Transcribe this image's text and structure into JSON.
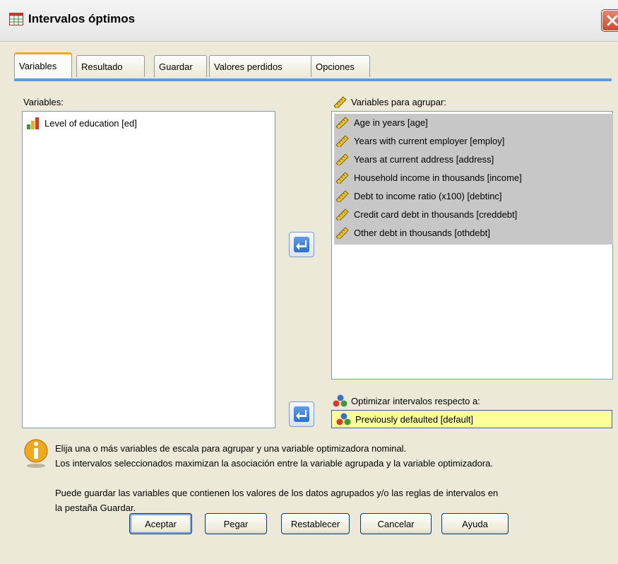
{
  "window": {
    "title": "Intervalos óptimos"
  },
  "tabs": [
    {
      "label": "Variables",
      "active": true
    },
    {
      "label": "Resultado",
      "active": false
    },
    {
      "label": "Guardar",
      "active": false
    },
    {
      "label": "Valores perdidos",
      "active": false
    },
    {
      "label": "Opciones",
      "active": false
    }
  ],
  "source_list": {
    "label": "Variables:",
    "items": [
      {
        "label": "Level of education [ed]",
        "icon": "ordinal-bar-icon"
      }
    ]
  },
  "bin_list": {
    "label": "Variables para agrupar:",
    "icon": "ruler-icon",
    "items": [
      {
        "label": "Age in years [age]",
        "icon": "ruler-icon"
      },
      {
        "label": "Years with current employer [employ]",
        "icon": "ruler-icon"
      },
      {
        "label": "Years at current address [address]",
        "icon": "ruler-icon"
      },
      {
        "label": "Household income in thousands [income]",
        "icon": "ruler-icon"
      },
      {
        "label": "Debt to income ratio (x100) [debtinc]",
        "icon": "ruler-icon"
      },
      {
        "label": "Credit card debt in thousands [creddebt]",
        "icon": "ruler-icon"
      },
      {
        "label": "Other debt in thousands [othdebt]",
        "icon": "ruler-icon"
      }
    ]
  },
  "optimize": {
    "label": "Optimizar intervalos respecto a:",
    "icon": "nominal-icon",
    "value": "Previously defaulted [default]"
  },
  "info": {
    "icon": "info-icon",
    "line1": "Elija una o más variables de escala para agrupar y una variable optimizadora nominal.",
    "line2": "Los intervalos seleccionados maximizan la asociación entre la variable agrupada y la variable optimizadora.",
    "line3": "Puede guardar las variables que contienen los valores de los datos agrupados y/o las reglas de intervalos en",
    "line4": "la pestaña Guardar."
  },
  "buttons": {
    "ok": "Aceptar",
    "paste": "Pegar",
    "reset": "Restablecer",
    "cancel": "Cancelar",
    "help": "Ayuda"
  },
  "colors": {
    "selection": "#c7c7c7",
    "target_highlight": "#ffff99",
    "tab_accent": "#f5a623",
    "arrow_button": "#2e6fc6"
  }
}
